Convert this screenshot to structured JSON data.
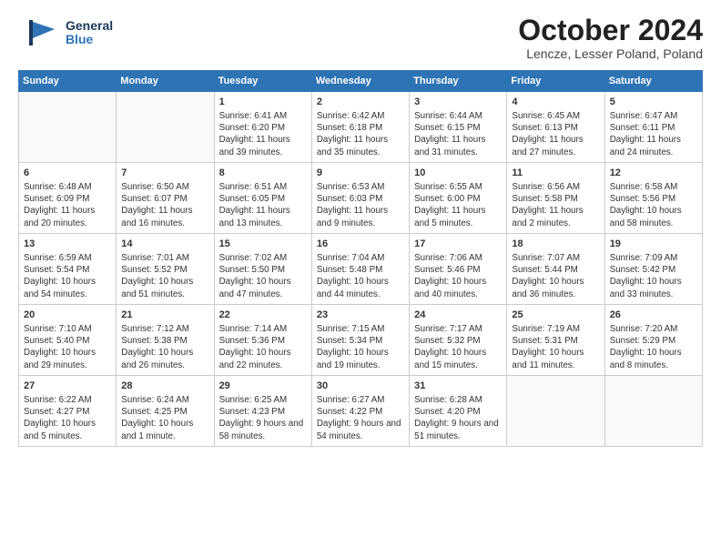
{
  "header": {
    "logo_general": "General",
    "logo_blue": "Blue",
    "month_title": "October 2024",
    "location": "Lencze, Lesser Poland, Poland"
  },
  "weekdays": [
    "Sunday",
    "Monday",
    "Tuesday",
    "Wednesday",
    "Thursday",
    "Friday",
    "Saturday"
  ],
  "weeks": [
    [
      {
        "day": "",
        "info": ""
      },
      {
        "day": "",
        "info": ""
      },
      {
        "day": "1",
        "info": "Sunrise: 6:41 AM\nSunset: 6:20 PM\nDaylight: 11 hours and 39 minutes."
      },
      {
        "day": "2",
        "info": "Sunrise: 6:42 AM\nSunset: 6:18 PM\nDaylight: 11 hours and 35 minutes."
      },
      {
        "day": "3",
        "info": "Sunrise: 6:44 AM\nSunset: 6:15 PM\nDaylight: 11 hours and 31 minutes."
      },
      {
        "day": "4",
        "info": "Sunrise: 6:45 AM\nSunset: 6:13 PM\nDaylight: 11 hours and 27 minutes."
      },
      {
        "day": "5",
        "info": "Sunrise: 6:47 AM\nSunset: 6:11 PM\nDaylight: 11 hours and 24 minutes."
      }
    ],
    [
      {
        "day": "6",
        "info": "Sunrise: 6:48 AM\nSunset: 6:09 PM\nDaylight: 11 hours and 20 minutes."
      },
      {
        "day": "7",
        "info": "Sunrise: 6:50 AM\nSunset: 6:07 PM\nDaylight: 11 hours and 16 minutes."
      },
      {
        "day": "8",
        "info": "Sunrise: 6:51 AM\nSunset: 6:05 PM\nDaylight: 11 hours and 13 minutes."
      },
      {
        "day": "9",
        "info": "Sunrise: 6:53 AM\nSunset: 6:03 PM\nDaylight: 11 hours and 9 minutes."
      },
      {
        "day": "10",
        "info": "Sunrise: 6:55 AM\nSunset: 6:00 PM\nDaylight: 11 hours and 5 minutes."
      },
      {
        "day": "11",
        "info": "Sunrise: 6:56 AM\nSunset: 5:58 PM\nDaylight: 11 hours and 2 minutes."
      },
      {
        "day": "12",
        "info": "Sunrise: 6:58 AM\nSunset: 5:56 PM\nDaylight: 10 hours and 58 minutes."
      }
    ],
    [
      {
        "day": "13",
        "info": "Sunrise: 6:59 AM\nSunset: 5:54 PM\nDaylight: 10 hours and 54 minutes."
      },
      {
        "day": "14",
        "info": "Sunrise: 7:01 AM\nSunset: 5:52 PM\nDaylight: 10 hours and 51 minutes."
      },
      {
        "day": "15",
        "info": "Sunrise: 7:02 AM\nSunset: 5:50 PM\nDaylight: 10 hours and 47 minutes."
      },
      {
        "day": "16",
        "info": "Sunrise: 7:04 AM\nSunset: 5:48 PM\nDaylight: 10 hours and 44 minutes."
      },
      {
        "day": "17",
        "info": "Sunrise: 7:06 AM\nSunset: 5:46 PM\nDaylight: 10 hours and 40 minutes."
      },
      {
        "day": "18",
        "info": "Sunrise: 7:07 AM\nSunset: 5:44 PM\nDaylight: 10 hours and 36 minutes."
      },
      {
        "day": "19",
        "info": "Sunrise: 7:09 AM\nSunset: 5:42 PM\nDaylight: 10 hours and 33 minutes."
      }
    ],
    [
      {
        "day": "20",
        "info": "Sunrise: 7:10 AM\nSunset: 5:40 PM\nDaylight: 10 hours and 29 minutes."
      },
      {
        "day": "21",
        "info": "Sunrise: 7:12 AM\nSunset: 5:38 PM\nDaylight: 10 hours and 26 minutes."
      },
      {
        "day": "22",
        "info": "Sunrise: 7:14 AM\nSunset: 5:36 PM\nDaylight: 10 hours and 22 minutes."
      },
      {
        "day": "23",
        "info": "Sunrise: 7:15 AM\nSunset: 5:34 PM\nDaylight: 10 hours and 19 minutes."
      },
      {
        "day": "24",
        "info": "Sunrise: 7:17 AM\nSunset: 5:32 PM\nDaylight: 10 hours and 15 minutes."
      },
      {
        "day": "25",
        "info": "Sunrise: 7:19 AM\nSunset: 5:31 PM\nDaylight: 10 hours and 11 minutes."
      },
      {
        "day": "26",
        "info": "Sunrise: 7:20 AM\nSunset: 5:29 PM\nDaylight: 10 hours and 8 minutes."
      }
    ],
    [
      {
        "day": "27",
        "info": "Sunrise: 6:22 AM\nSunset: 4:27 PM\nDaylight: 10 hours and 5 minutes."
      },
      {
        "day": "28",
        "info": "Sunrise: 6:24 AM\nSunset: 4:25 PM\nDaylight: 10 hours and 1 minute."
      },
      {
        "day": "29",
        "info": "Sunrise: 6:25 AM\nSunset: 4:23 PM\nDaylight: 9 hours and 58 minutes."
      },
      {
        "day": "30",
        "info": "Sunrise: 6:27 AM\nSunset: 4:22 PM\nDaylight: 9 hours and 54 minutes."
      },
      {
        "day": "31",
        "info": "Sunrise: 6:28 AM\nSunset: 4:20 PM\nDaylight: 9 hours and 51 minutes."
      },
      {
        "day": "",
        "info": ""
      },
      {
        "day": "",
        "info": ""
      }
    ]
  ]
}
